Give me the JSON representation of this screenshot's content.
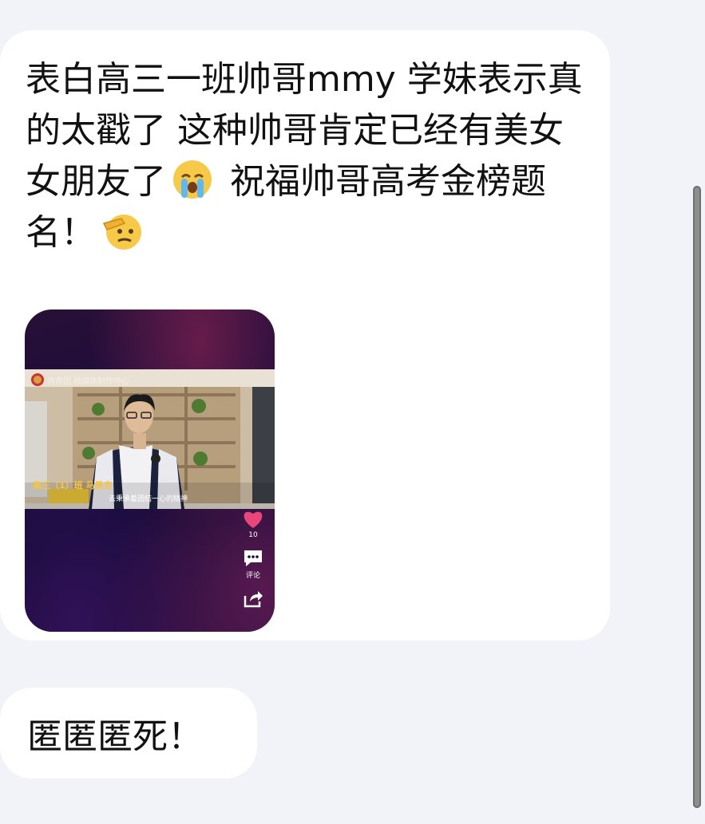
{
  "messages": [
    {
      "text_parts": [
        "表白高三一班帅哥mmy 学妹表示真的太戳了 这种帅哥肯定已经有美女女朋友了",
        " 祝福帅哥高考金榜题名！"
      ],
      "emojis": [
        "loudly-crying-face-emoji",
        "saluting-face-emoji"
      ],
      "video": {
        "channel_text": "共青团 融媒体制作中心",
        "caption_name": "高三（1）班 马昊言",
        "subtitle": "去秉承着团结一心的精神",
        "likes": "10",
        "comment_label": "评论"
      }
    },
    {
      "text": "匿匿匿死！"
    }
  ],
  "colors": {
    "background": "#f2f3f8",
    "bubble": "#ffffff",
    "text": "#111111",
    "like": "#e8467a"
  },
  "icons": [
    "heart-icon",
    "comment-icon",
    "share-icon"
  ]
}
